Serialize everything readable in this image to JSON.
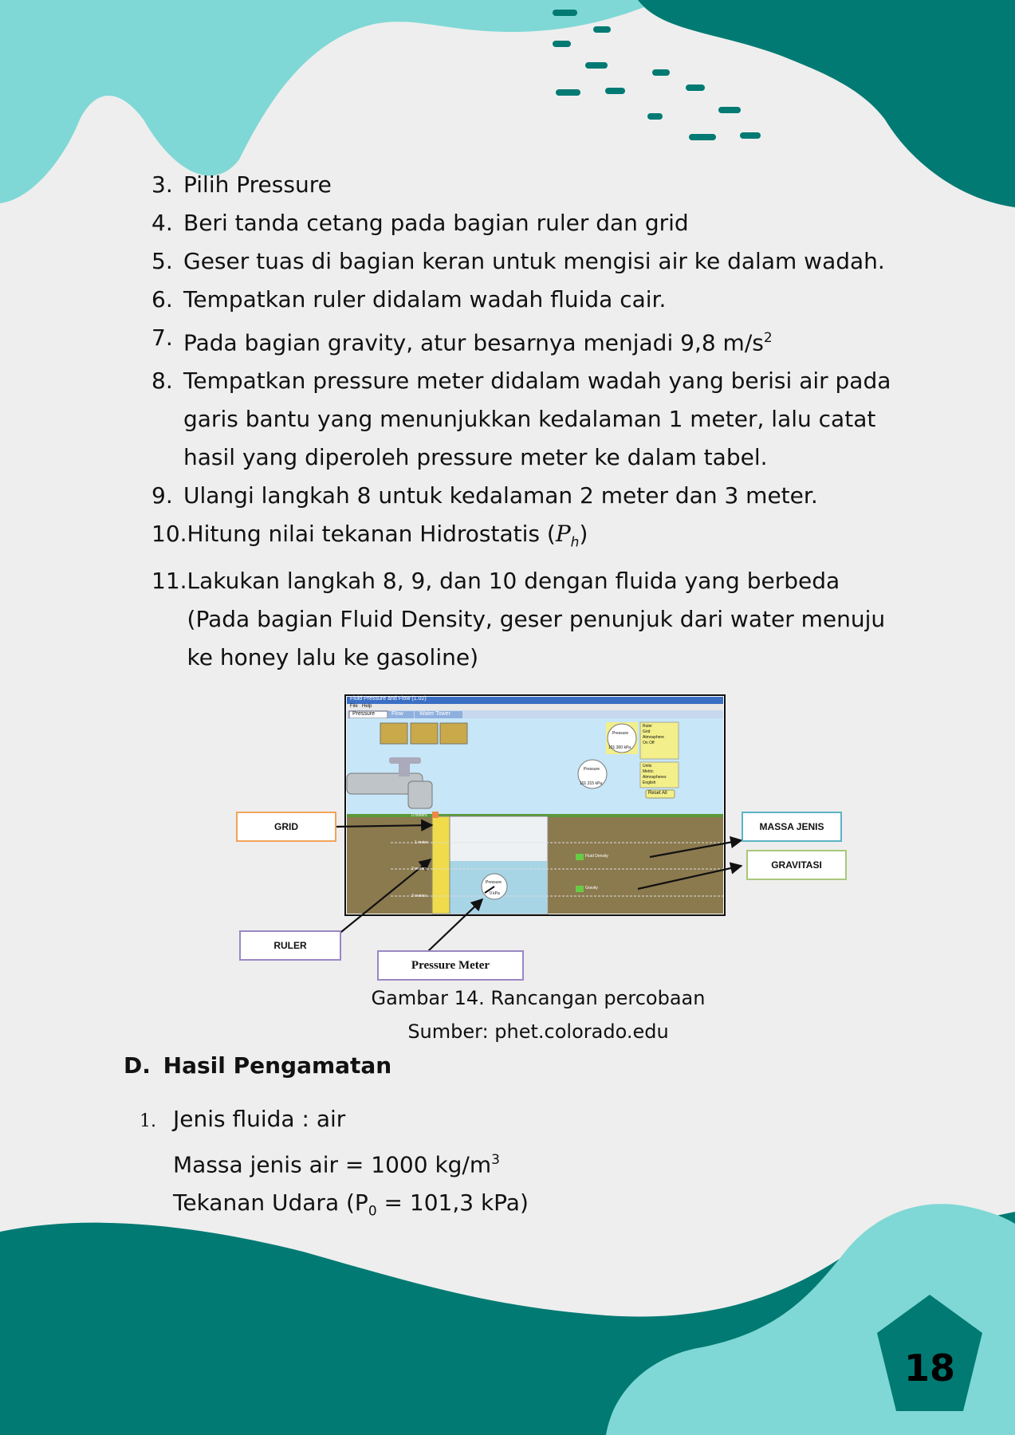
{
  "steps": [
    {
      "num": "3.",
      "text": "Pilih Pressure"
    },
    {
      "num": "4.",
      "text": "Beri tanda cetang pada bagian ruler dan grid"
    },
    {
      "num": "5.",
      "text": "Geser tuas di bagian keran untuk mengisi air ke dalam wadah."
    },
    {
      "num": "6.",
      "text": "Tempatkan ruler didalam wadah fluida cair."
    },
    {
      "num": "7.",
      "text": "Pada bagian gravity, atur besarnya menjadi 9,8 m/s",
      "sup": "2"
    },
    {
      "num": "8.",
      "text": "Tempatkan pressure meter didalam wadah yang berisi air pada garis bantu yang menunjukkan kedalaman 1 meter, lalu catat hasil yang diperoleh pressure meter ke dalam tabel."
    },
    {
      "num": "9.",
      "text": "Ulangi langkah 8 untuk kedalaman 2 meter dan 3 meter."
    },
    {
      "num": "10.",
      "text": "Hitung nilai tekanan Hidrostatis (",
      "var": "P",
      "sub": "h",
      "after": ")"
    },
    {
      "num": "11.",
      "text": "Lakukan langkah 8, 9, dan 10 dengan fluida yang berbeda (Pada bagian Fluid Density, geser penunjuk dari water menuju ke honey lalu ke gasoline)"
    }
  ],
  "figure": {
    "window_title": "Fluid Pressure and Flow (1.02)",
    "menu": [
      "File",
      "Help"
    ],
    "tabs": [
      "Pressure",
      "Flow",
      "Water Tower"
    ],
    "gauge1": {
      "label": "Pressure",
      "value": "101.300 kPa"
    },
    "gauge2": {
      "label": "Pressure",
      "value": "101.315 kPa"
    },
    "gauge3": {
      "label": "Pressure",
      "value": "0 kPa"
    },
    "controls": [
      "Ruler",
      "Grid",
      "Atmosphere",
      "On",
      "Off"
    ],
    "units": [
      "Units",
      "Metric",
      "Atmospheres",
      "English"
    ],
    "reset": "Reset All",
    "ruler_marks": [
      "0 meters",
      "1 meter",
      "2 meters",
      "3 meters"
    ],
    "sliders": [
      "Fluid Density",
      "Gravity"
    ],
    "labels": {
      "grid": "GRID",
      "ruler": "RULER",
      "pressure_meter": "Pressure Meter",
      "massa_jenis": "MASSA JENIS",
      "gravitasi": "GRAVITASI"
    }
  },
  "caption": {
    "title": "Gambar 14. Rancangan percobaan",
    "source": "Sumber: phet.colorado.edu"
  },
  "section": {
    "letter": "D.",
    "title": "Hasil Pengamatan"
  },
  "observation": {
    "num": "1.",
    "line1": "Jenis fluida : air",
    "line2": "Massa jenis air = 1000 kg/m",
    "line2_sup": "3",
    "line3_pre": "Tekanan Udara (P",
    "line3_sub": "0",
    "line3_post": " = 101,3 kPa)"
  },
  "page_number": "18",
  "colors": {
    "dark_teal": "#007a73",
    "light_teal": "#7fd8d5",
    "paper": "#efefef"
  }
}
